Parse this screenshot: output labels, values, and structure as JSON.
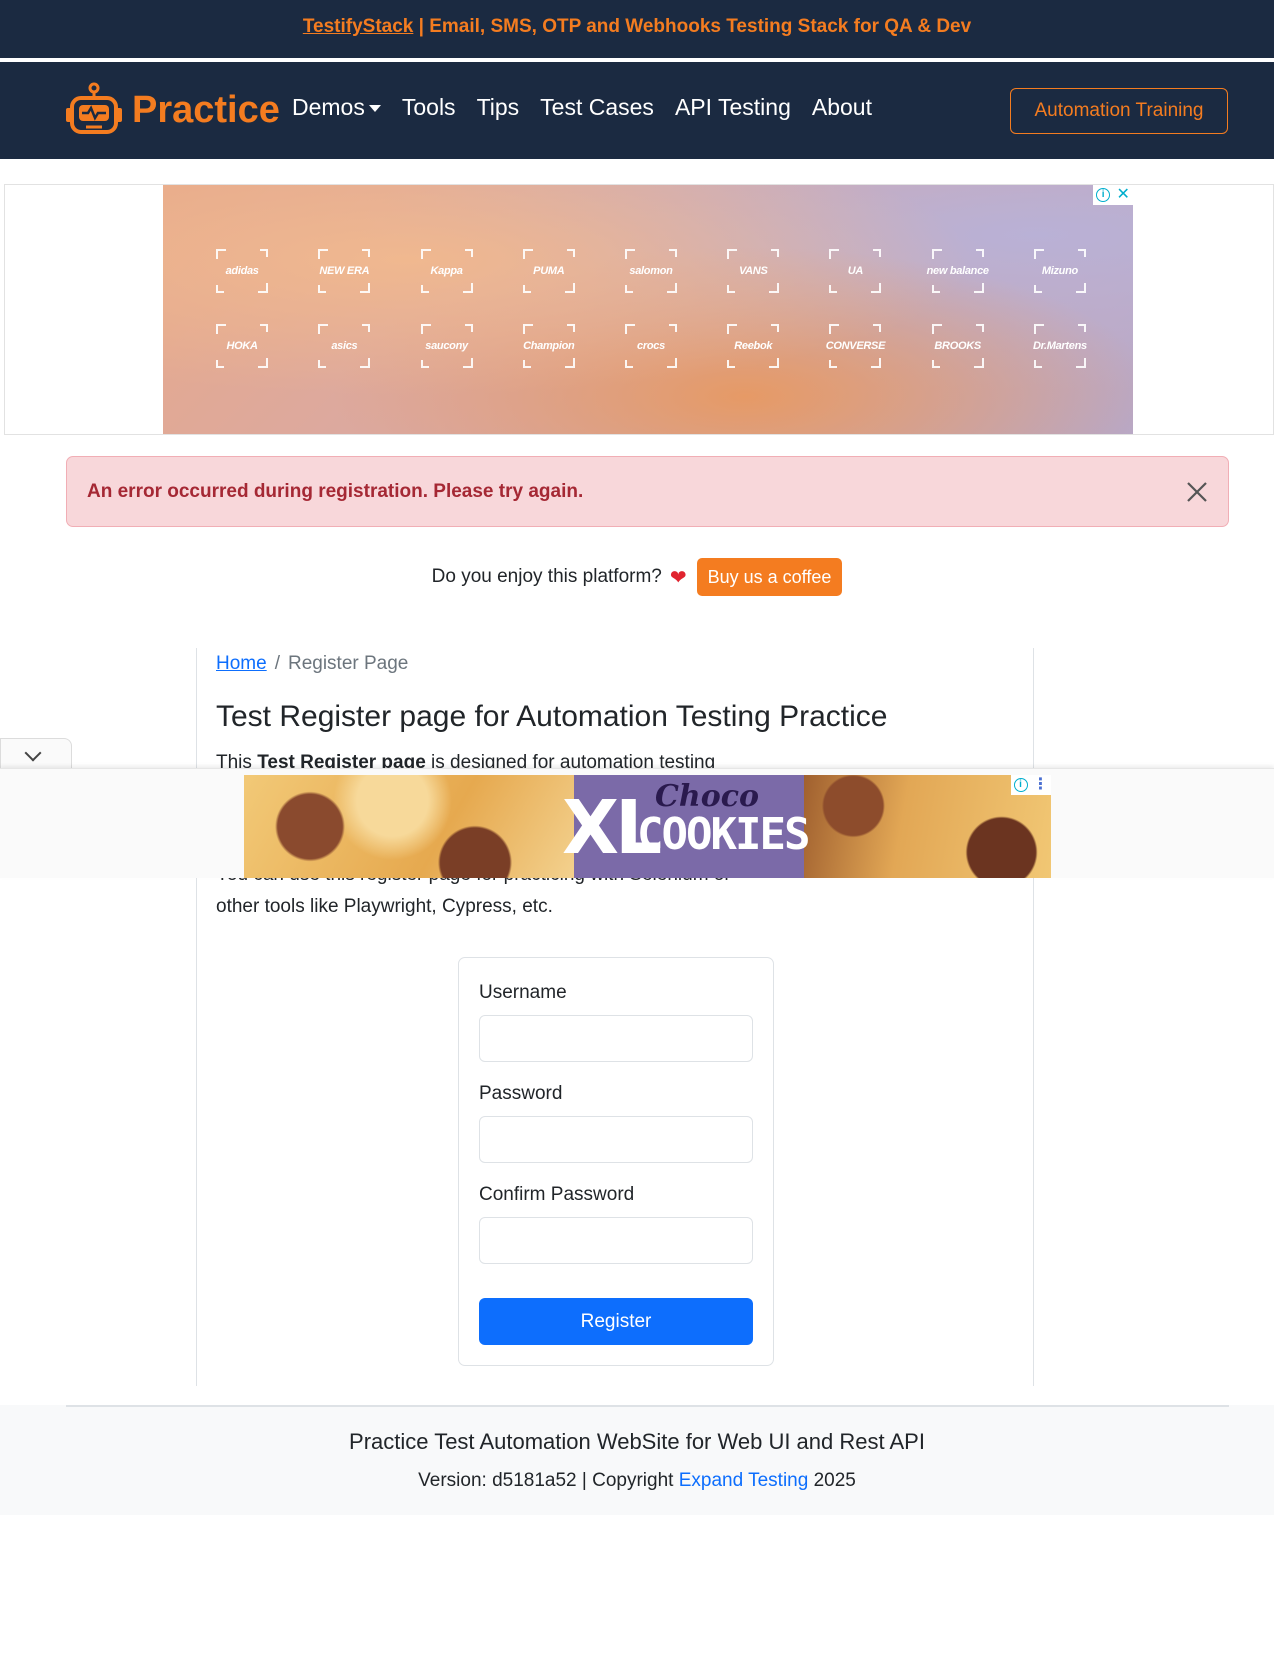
{
  "top_banner": {
    "link_text": "TestifyStack",
    "text": " | Email, SMS, OTP and Webhooks Testing Stack for QA & Dev"
  },
  "navbar": {
    "brand": "Practice",
    "links": [
      "Demos",
      "Tools",
      "Tips",
      "Test Cases",
      "API Testing",
      "About"
    ],
    "training_button": "Automation Training"
  },
  "top_ad": {
    "brands_row1": [
      "adidas",
      "NEW ERA",
      "Kappa",
      "PUMA",
      "salomon",
      "VANS",
      "UA",
      "new balance",
      "Mizuno"
    ],
    "brands_row2": [
      "HOKA",
      "asics",
      "saucony",
      "Champion",
      "crocs",
      "Reebok",
      "CONVERSE",
      "BROOKS",
      "Dr.Martens"
    ]
  },
  "alert": {
    "message": "An error occurred during registration. Please try again."
  },
  "coffee": {
    "question": "Do you enjoy this platform?",
    "button": "Buy us a coffee"
  },
  "breadcrumb": {
    "home": "Home",
    "current": "Register Page"
  },
  "main": {
    "title": "Test Register page for Automation Testing Practice",
    "intro_prefix": "This ",
    "intro_bold": "Test Register page",
    "intro_suffix": " is designed for automation testing",
    "para2_line1": "You can use this register page for practicing with Selenium or",
    "para2_line2": "other tools like Playwright, Cypress, etc."
  },
  "form": {
    "username_label": "Username",
    "username_value": "",
    "password_label": "Password",
    "password_value": "",
    "confirm_label": "Confirm Password",
    "confirm_value": "",
    "register_button": "Register"
  },
  "anchor_ad": {
    "headline_xl": "XL",
    "headline_choco": "Choco",
    "headline_cookies": "COOKIES"
  },
  "footer": {
    "title": "Practice Test Automation WebSite for Web UI and Rest API",
    "version_prefix": "Version: d5181a52 | Copyright ",
    "company_link": "Expand Testing",
    "year": " 2025"
  },
  "colors": {
    "navbar_bg": "#1b2a41",
    "accent_orange": "#f47c20",
    "primary_blue": "#0d6efd",
    "alert_bg": "#f8d7da",
    "alert_text": "#a52834"
  }
}
